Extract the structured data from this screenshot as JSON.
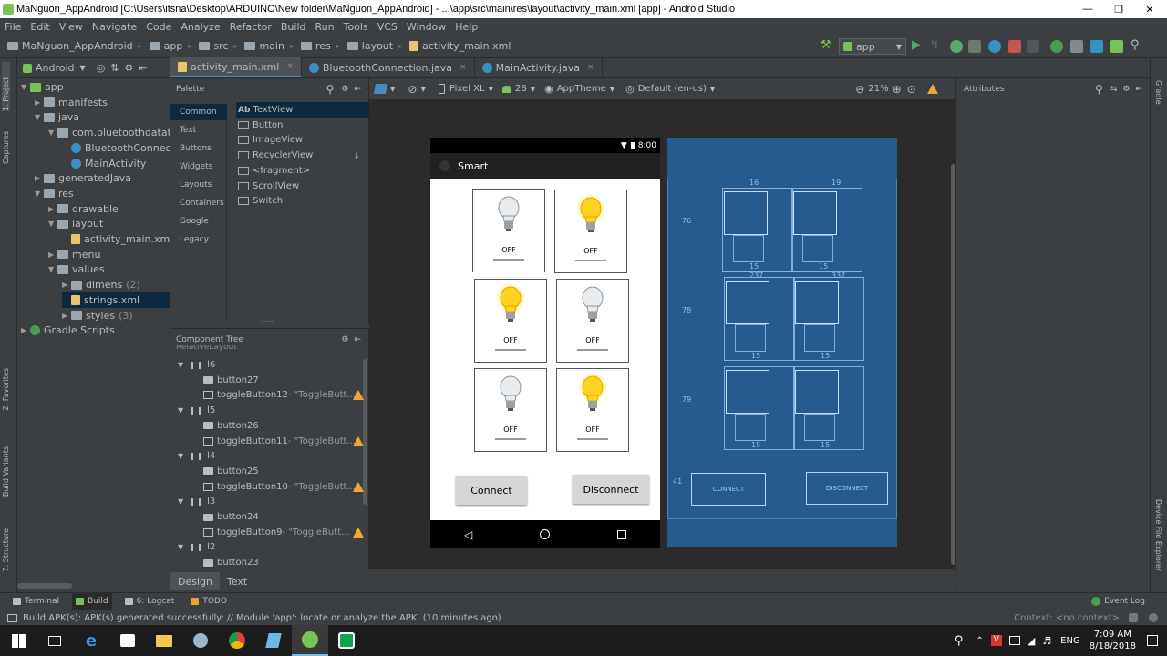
{
  "window": {
    "title": "MaNguon_AppAndroid [C:\\Users\\itsna\\Desktop\\ARDUINO\\New folder\\MaNguon_AppAndroid] - ...\\app\\src\\main\\res\\layout\\activity_main.xml [app] - Android Studio"
  },
  "menu": [
    "File",
    "Edit",
    "View",
    "Navigate",
    "Code",
    "Analyze",
    "Refactor",
    "Build",
    "Run",
    "Tools",
    "VCS",
    "Window",
    "Help"
  ],
  "breadcrumbs": [
    "MaNguon_AppAndroid",
    "app",
    "src",
    "main",
    "res",
    "layout",
    "activity_main.xml"
  ],
  "toolbar": {
    "run_config": "app"
  },
  "left_strip": {
    "project": "1: Project",
    "captures": "Captures",
    "favorites": "2: Favorites",
    "build_variants": "Build Variants",
    "structure": "7: Structure"
  },
  "right_strip": {
    "gradle": "Gradle",
    "device_explorer": "Device File Explorer"
  },
  "project": {
    "view": "Android",
    "tree": [
      {
        "label": "app",
        "depth": 0,
        "open": true,
        "icon": "folder"
      },
      {
        "label": "manifests",
        "depth": 1,
        "open": false,
        "icon": "folder"
      },
      {
        "label": "java",
        "depth": 1,
        "open": true,
        "icon": "folder"
      },
      {
        "label": "com.bluetoothdatatranf",
        "depth": 2,
        "open": true,
        "icon": "folder"
      },
      {
        "label": "BluetoothConnection",
        "depth": 3,
        "open": null,
        "icon": "java"
      },
      {
        "label": "MainActivity",
        "depth": 3,
        "open": null,
        "icon": "java"
      },
      {
        "label": "generatedJava",
        "depth": 1,
        "open": false,
        "icon": "folder"
      },
      {
        "label": "res",
        "depth": 1,
        "open": true,
        "icon": "folder"
      },
      {
        "label": "drawable",
        "depth": 2,
        "open": false,
        "icon": "folder"
      },
      {
        "label": "layout",
        "depth": 2,
        "open": true,
        "icon": "folder"
      },
      {
        "label": "activity_main.xml",
        "depth": 3,
        "open": null,
        "icon": "xml"
      },
      {
        "label": "menu",
        "depth": 2,
        "open": false,
        "icon": "folder"
      },
      {
        "label": "values",
        "depth": 2,
        "open": true,
        "icon": "folder"
      },
      {
        "label": "dimens",
        "count": "(2)",
        "depth": 3,
        "open": false,
        "icon": "folder"
      },
      {
        "label": "strings.xml",
        "depth": 3,
        "open": null,
        "icon": "xml",
        "selected": true
      },
      {
        "label": "styles",
        "count": "(3)",
        "depth": 3,
        "open": false,
        "icon": "folder"
      },
      {
        "label": "Gradle Scripts",
        "depth": 0,
        "open": false,
        "icon": "gradle"
      }
    ]
  },
  "editor_tabs": [
    {
      "label": "activity_main.xml",
      "active": true
    },
    {
      "label": "BluetoothConnection.java",
      "active": false
    },
    {
      "label": "MainActivity.java",
      "active": false
    }
  ],
  "palette": {
    "title": "Palette",
    "categories": [
      "Common",
      "Text",
      "Buttons",
      "Widgets",
      "Layouts",
      "Containers",
      "Google",
      "Legacy"
    ],
    "items": [
      "TextView",
      "Button",
      "ImageView",
      "RecyclerView",
      "<fragment>",
      "ScrollView",
      "Switch"
    ],
    "textview_prefix": "Ab"
  },
  "component_tree": {
    "title": "Component Tree",
    "root": "RelativeLayout",
    "rows": [
      {
        "label": "l6",
        "depth": 0,
        "warn": false
      },
      {
        "label": "button27",
        "depth": 1,
        "warn": false
      },
      {
        "label": "toggleButton12",
        "suffix": "- \"ToggleButt...",
        "depth": 1,
        "warn": true
      },
      {
        "label": "l5",
        "depth": 0,
        "warn": false
      },
      {
        "label": "button26",
        "depth": 1,
        "warn": false
      },
      {
        "label": "toggleButton11",
        "suffix": "- \"ToggleButt...",
        "depth": 1,
        "warn": true
      },
      {
        "label": "l4",
        "depth": 0,
        "warn": false
      },
      {
        "label": "button25",
        "depth": 1,
        "warn": false
      },
      {
        "label": "toggleButton10",
        "suffix": "- \"ToggleButt...",
        "depth": 1,
        "warn": true
      },
      {
        "label": "l3",
        "depth": 0,
        "warn": false
      },
      {
        "label": "button24",
        "depth": 1,
        "warn": false
      },
      {
        "label": "toggleButton9",
        "suffix": "- \"ToggleButt...",
        "depth": 1,
        "warn": true
      },
      {
        "label": "l2",
        "depth": 0,
        "warn": false
      },
      {
        "label": "button23",
        "depth": 1,
        "warn": false
      }
    ]
  },
  "design_toolbar": {
    "device": "Pixel XL",
    "api": "28",
    "theme": "AppTheme",
    "locale": "Default (en-us)",
    "zoom": "21%"
  },
  "attributes": {
    "title": "Attributes"
  },
  "phone": {
    "time": "8:00",
    "app_title": "Smart",
    "bulbs": [
      {
        "state": "OFF",
        "lit": false
      },
      {
        "state": "OFF",
        "lit": true
      },
      {
        "state": "OFF",
        "lit": true
      },
      {
        "state": "OFF",
        "lit": false
      },
      {
        "state": "OFF",
        "lit": false
      },
      {
        "state": "OFF",
        "lit": true
      }
    ],
    "connect": "Connect",
    "disconnect": "Disconnect"
  },
  "blueprint": {
    "margins": [
      "76",
      "78",
      "79",
      "41"
    ],
    "top_labels": [
      "16",
      "19"
    ],
    "bottom_labels": [
      "15",
      "15",
      "15",
      "15",
      "15",
      "15"
    ],
    "mid_labels": [
      "237",
      "337"
    ],
    "connect": "CONNECT",
    "disconnect": "DISCONNECT"
  },
  "design_tabs": [
    {
      "label": "Design",
      "active": true
    },
    {
      "label": "Text",
      "active": false
    }
  ],
  "bottom_tools": [
    {
      "label": "Terminal",
      "active": false
    },
    {
      "label": "Build",
      "active": true
    },
    {
      "label": "6: Logcat",
      "active": false
    },
    {
      "label": "TODO",
      "active": false
    }
  ],
  "event_log": "Event Log",
  "status": {
    "message": "Build APK(s): APK(s) generated successfully: // Module 'app': locate or analyze the APK. (10 minutes ago)",
    "context": "Context: <no context>"
  },
  "taskbar": {
    "lang": "ENG",
    "time": "7:09 AM",
    "date": "8/18/2018"
  },
  "colors": {
    "accent": "#4a88c7",
    "blueprint": "#245b91",
    "warning": "#f0a732"
  }
}
